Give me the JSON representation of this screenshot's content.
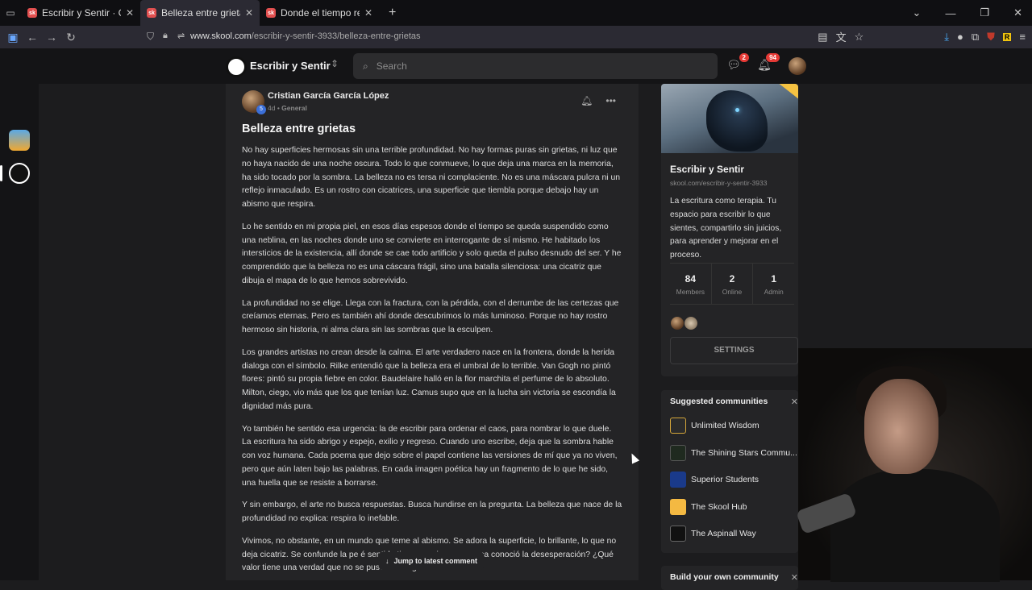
{
  "browser": {
    "tabs": [
      {
        "label": "Escribir y Sentir · General",
        "active": false
      },
      {
        "label": "Belleza entre grietas · Escribir y Sentir",
        "active": true
      },
      {
        "label": "Donde el tiempo respira tu nombre",
        "active": false
      }
    ],
    "url_domain": "www.skool.com",
    "url_path": "/escribir-y-sentir-3933/belleza-entre-grietas"
  },
  "header": {
    "community_name": "Escribir y Sentir",
    "search_placeholder": "Search",
    "chat_badge": "2",
    "notif_badge": "94"
  },
  "post": {
    "author": "Cristian García García López",
    "level": "5",
    "time": "4d",
    "category": "General",
    "title": "Belleza entre grietas",
    "paragraphs": [
      "No hay superficies hermosas sin una terrible profundidad. No hay formas puras sin grietas, ni luz que no haya nacido de una noche oscura. Todo lo que conmueve, lo que deja una marca en la memoria, ha sido tocado por la sombra. La belleza no es tersa ni complaciente. No es una máscara pulcra ni un reflejo inmaculado. Es un rostro con cicatrices, una superficie que tiembla porque debajo hay un abismo que respira.",
      "Lo he sentido en mi propia piel, en esos días espesos donde el tiempo se queda suspendido como una neblina, en las noches donde uno se convierte en interrogante de sí mismo. He habitado los intersticios de la existencia, allí donde se cae todo artificio y solo queda el pulso desnudo del ser. Y he comprendido que la belleza no es una cáscara frágil, sino una batalla silenciosa: una cicatriz que dibuja el mapa de lo que hemos sobrevivido.",
      "La profundidad no se elige. Llega con la fractura, con la pérdida, con el derrumbe de las certezas que creíamos eternas. Pero es también ahí donde descubrimos lo más luminoso. Porque no hay rostro hermoso sin historia, ni alma clara sin las sombras que la esculpen.",
      "Los grandes artistas no crean desde la calma. El arte verdadero nace en la frontera, donde la herida dialoga con el símbolo. Rilke entendió que la belleza era el umbral de lo terrible. Van Gogh no pintó flores: pintó su propia fiebre en color. Baudelaire halló en la flor marchita el perfume de lo absoluto. Milton, ciego, vio más que los que tenían luz. Camus supo que en la lucha sin victoria se escondía la dignidad más pura.",
      "Yo también he sentido esa urgencia: la de escribir para ordenar el caos, para nombrar lo que duele. La escritura ha sido abrigo y espejo, exilio y regreso. Cuando uno escribe, deja que la sombra hable con voz humana. Cada poema que dejo sobre el papel contiene las versiones de mí que ya no viven, pero que aún laten bajo las palabras. En cada imagen poética hay un fragmento de lo que he sido, una huella que se resiste a borrarse.",
      "Y sin embargo, el arte no busca respuestas. Busca hundirse en la pregunta. La belleza que nace de la profundidad no explica: respira lo inefable.",
      "Vivimos, no obstante, en un mundo que teme al abismo. Se adora la superficie, lo brillante, lo que no deja cicatriz. Se confunde la pe                           é sentido tiene una risa que nunca conoció la desesperación? ¿Qué valor tiene una verdad que no se puso en riesgo? Lo llano"
    ],
    "jump_label": "Jump to latest comment"
  },
  "community_card": {
    "name": "Escribir y Sentir",
    "url": "skool.com/escribir-y-sentir-3933",
    "description": "La escritura como terapia. Tu espacio para escribir lo que sientes, compartirlo sin juicios, para aprender y mejorar en el proceso.",
    "stats": [
      {
        "value": "84",
        "label": "Members"
      },
      {
        "value": "2",
        "label": "Online"
      },
      {
        "value": "1",
        "label": "Admin"
      }
    ],
    "settings_label": "SETTINGS"
  },
  "suggested": {
    "title": "Suggested communities",
    "items": [
      {
        "label": "Unlimited Wisdom",
        "color": "#2b2b2b"
      },
      {
        "label": "The Shining Stars Commu...",
        "color": "#1f2a1f"
      },
      {
        "label": "Superior Students",
        "color": "#1a3a8a"
      },
      {
        "label": "The Skool Hub",
        "color": "#f4b942"
      },
      {
        "label": "The Aspinall Way",
        "color": "#111111"
      }
    ]
  },
  "build": {
    "title": "Build your own community"
  }
}
